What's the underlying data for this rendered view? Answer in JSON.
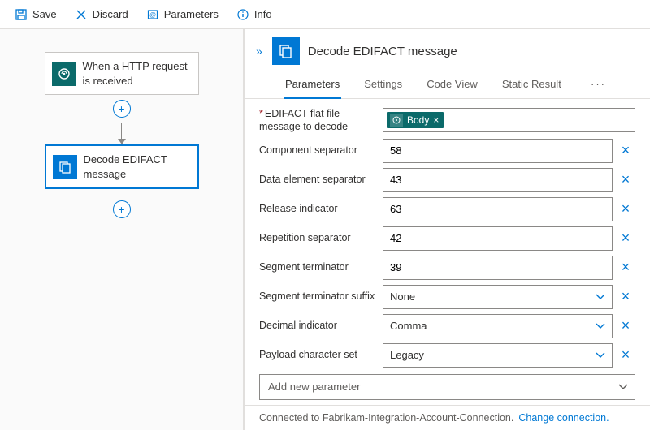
{
  "toolbar": {
    "save": "Save",
    "discard": "Discard",
    "parameters": "Parameters",
    "info": "Info"
  },
  "flow": {
    "trigger": {
      "title": "When a HTTP request is received"
    },
    "action": {
      "title": "Decode EDIFACT message"
    }
  },
  "panel": {
    "title": "Decode EDIFACT message",
    "tabs": {
      "parameters": "Parameters",
      "settings": "Settings",
      "codeview": "Code View",
      "staticresult": "Static Result"
    },
    "fields": {
      "edifact_flat_file": {
        "label": "EDIFACT flat file message to decode",
        "token": "Body"
      },
      "component_separator": {
        "label": "Component separator",
        "value": "58"
      },
      "data_element_separator": {
        "label": "Data element separator",
        "value": "43"
      },
      "release_indicator": {
        "label": "Release indicator",
        "value": "63"
      },
      "repetition_separator": {
        "label": "Repetition separator",
        "value": "42"
      },
      "segment_terminator": {
        "label": "Segment terminator",
        "value": "39"
      },
      "segment_terminator_suffix": {
        "label": "Segment terminator suffix",
        "value": "None"
      },
      "decimal_indicator": {
        "label": "Decimal indicator",
        "value": "Comma"
      },
      "payload_character_set": {
        "label": "Payload character set",
        "value": "Legacy"
      }
    },
    "add_parameter": "Add new parameter",
    "footer": {
      "connected": "Connected to Fabrikam-Integration-Account-Connection.",
      "change": "Change connection."
    }
  }
}
